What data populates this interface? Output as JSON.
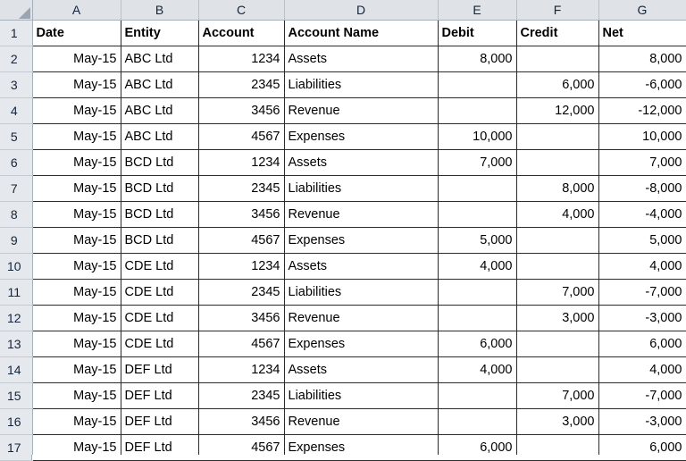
{
  "spreadsheet": {
    "corner_icon": "select-all-triangle-icon",
    "column_letters": [
      "A",
      "B",
      "C",
      "D",
      "E",
      "F",
      "G"
    ],
    "row_numbers": [
      "1",
      "2",
      "3",
      "4",
      "5",
      "6",
      "7",
      "8",
      "9",
      "10",
      "11",
      "12",
      "13",
      "14",
      "15",
      "16",
      "17"
    ],
    "header_row": {
      "date": "Date",
      "entity": "Entity",
      "account": "Account",
      "account_name": "Account Name",
      "debit": "Debit",
      "credit": "Credit",
      "net": "Net"
    },
    "columns": [
      "Date",
      "Entity",
      "Account",
      "Account Name",
      "Debit",
      "Credit",
      "Net"
    ],
    "rows": [
      {
        "row": "2",
        "date": "May-15",
        "entity": "ABC Ltd",
        "account": "1234",
        "account_name": "Assets",
        "debit": "8,000",
        "credit": "",
        "net": "8,000"
      },
      {
        "row": "3",
        "date": "May-15",
        "entity": "ABC Ltd",
        "account": "2345",
        "account_name": "Liabilities",
        "debit": "",
        "credit": "6,000",
        "net": "-6,000"
      },
      {
        "row": "4",
        "date": "May-15",
        "entity": "ABC Ltd",
        "account": "3456",
        "account_name": "Revenue",
        "debit": "",
        "credit": "12,000",
        "net": "-12,000"
      },
      {
        "row": "5",
        "date": "May-15",
        "entity": "ABC Ltd",
        "account": "4567",
        "account_name": "Expenses",
        "debit": "10,000",
        "credit": "",
        "net": "10,000"
      },
      {
        "row": "6",
        "date": "May-15",
        "entity": "BCD Ltd",
        "account": "1234",
        "account_name": "Assets",
        "debit": "7,000",
        "credit": "",
        "net": "7,000"
      },
      {
        "row": "7",
        "date": "May-15",
        "entity": "BCD Ltd",
        "account": "2345",
        "account_name": "Liabilities",
        "debit": "",
        "credit": "8,000",
        "net": "-8,000"
      },
      {
        "row": "8",
        "date": "May-15",
        "entity": "BCD Ltd",
        "account": "3456",
        "account_name": "Revenue",
        "debit": "",
        "credit": "4,000",
        "net": "-4,000"
      },
      {
        "row": "9",
        "date": "May-15",
        "entity": "BCD Ltd",
        "account": "4567",
        "account_name": "Expenses",
        "debit": "5,000",
        "credit": "",
        "net": "5,000"
      },
      {
        "row": "10",
        "date": "May-15",
        "entity": "CDE Ltd",
        "account": "1234",
        "account_name": "Assets",
        "debit": "4,000",
        "credit": "",
        "net": "4,000"
      },
      {
        "row": "11",
        "date": "May-15",
        "entity": "CDE Ltd",
        "account": "2345",
        "account_name": "Liabilities",
        "debit": "",
        "credit": "7,000",
        "net": "-7,000"
      },
      {
        "row": "12",
        "date": "May-15",
        "entity": "CDE Ltd",
        "account": "3456",
        "account_name": "Revenue",
        "debit": "",
        "credit": "3,000",
        "net": "-3,000"
      },
      {
        "row": "13",
        "date": "May-15",
        "entity": "CDE Ltd",
        "account": "4567",
        "account_name": "Expenses",
        "debit": "6,000",
        "credit": "",
        "net": "6,000"
      },
      {
        "row": "14",
        "date": "May-15",
        "entity": "DEF Ltd",
        "account": "1234",
        "account_name": "Assets",
        "debit": "4,000",
        "credit": "",
        "net": "4,000"
      },
      {
        "row": "15",
        "date": "May-15",
        "entity": "DEF Ltd",
        "account": "2345",
        "account_name": "Liabilities",
        "debit": "",
        "credit": "7,000",
        "net": "-7,000"
      },
      {
        "row": "16",
        "date": "May-15",
        "entity": "DEF Ltd",
        "account": "3456",
        "account_name": "Revenue",
        "debit": "",
        "credit": "3,000",
        "net": "-3,000"
      },
      {
        "row": "17",
        "date": "May-15",
        "entity": "DEF Ltd",
        "account": "4567",
        "account_name": "Expenses",
        "debit": "6,000",
        "credit": "",
        "net": "6,000"
      }
    ]
  },
  "colors": {
    "header_bg": "#dfe3e8",
    "rowhead_bg": "#e5e9ee",
    "cell_border": "#2b2b2b",
    "cell_bg": "#ffffff",
    "text": "#000000"
  }
}
